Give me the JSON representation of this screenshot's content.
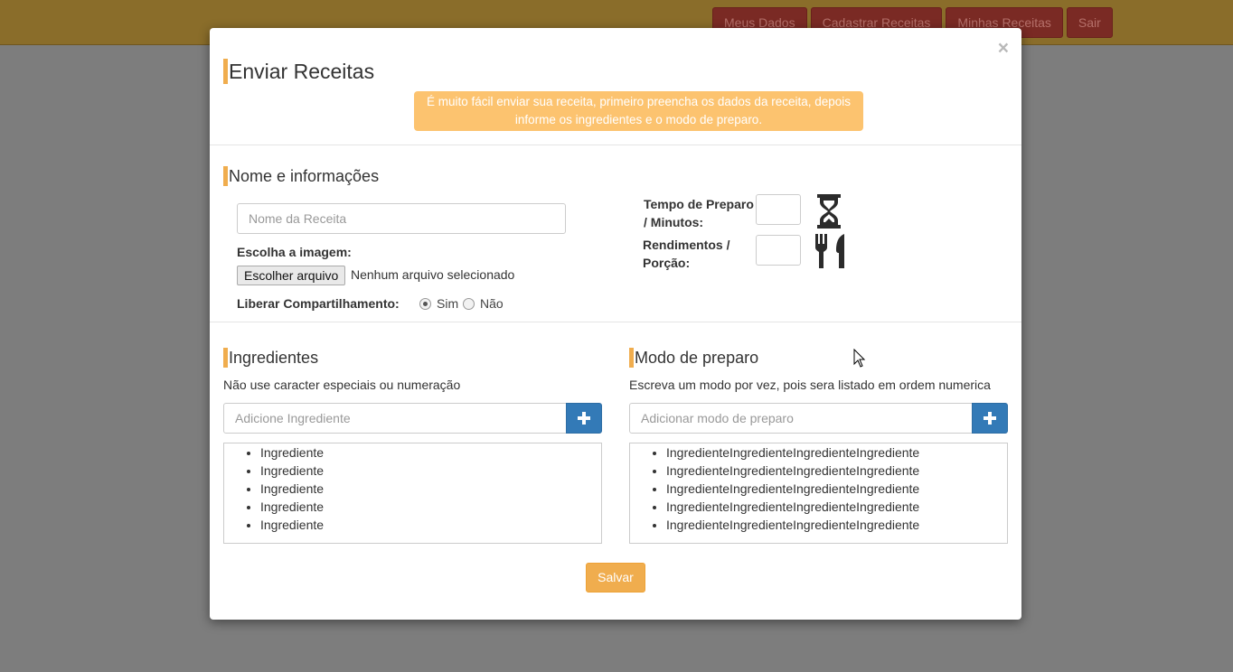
{
  "navbar": {
    "buttons": [
      "Meus Dados",
      "Cadastrar Receitas",
      "Minhas Receitas",
      "Sair"
    ]
  },
  "modal": {
    "close": "×",
    "title": "Enviar Receitas",
    "alert_line1": "É muito fácil enviar sua receita, primeiro preencha os dados da receita, depois",
    "alert_line2": "informe os ingredientes e o modo de preparo."
  },
  "info": {
    "heading": "Nome e informações",
    "name_placeholder": "Nome da Receita",
    "image_label": "Escolha a imagem:",
    "file_button": "Escolher arquivo",
    "file_status": "Nenhum arquivo selecionado",
    "share_label": "Liberar Compartilhamento:",
    "share_yes": "Sim",
    "share_no": "Não",
    "share_selected": "Sim",
    "prep_time_label_1": "Tempo de Preparo",
    "prep_time_label_2": "/ Minutos:",
    "yield_label_1": "Rendimentos /",
    "yield_label_2": "Porção:",
    "prep_time_icon": "hourglass-icon",
    "yield_icon": "cutlery-icon"
  },
  "ingredients": {
    "heading": "Ingredientes",
    "hint": "Não use caracter especiais ou numeração",
    "placeholder": "Adicione Ingrediente",
    "add_icon": "plus-icon",
    "items": [
      "Ingrediente",
      "Ingrediente",
      "Ingrediente",
      "Ingrediente",
      "Ingrediente"
    ]
  },
  "preparation": {
    "heading": "Modo de preparo",
    "hint": "Escreva um modo por vez, pois sera listado em ordem numerica",
    "placeholder": "Adicionar modo de preparo",
    "add_icon": "plus-icon",
    "items": [
      "IngredienteIngredienteIngredienteIngrediente",
      "IngredienteIngredienteIngredienteIngrediente",
      "IngredienteIngredienteIngredienteIngrediente",
      "IngredienteIngredienteIngredienteIngrediente",
      "IngredienteIngredienteIngredienteIngrediente"
    ]
  },
  "footer": {
    "save_label": "Salvar"
  },
  "colors": {
    "accent": "#f0ad4e",
    "alert_bg": "#fcc36f",
    "primary": "#337ab7",
    "backdrop": "#7d7d7d"
  }
}
